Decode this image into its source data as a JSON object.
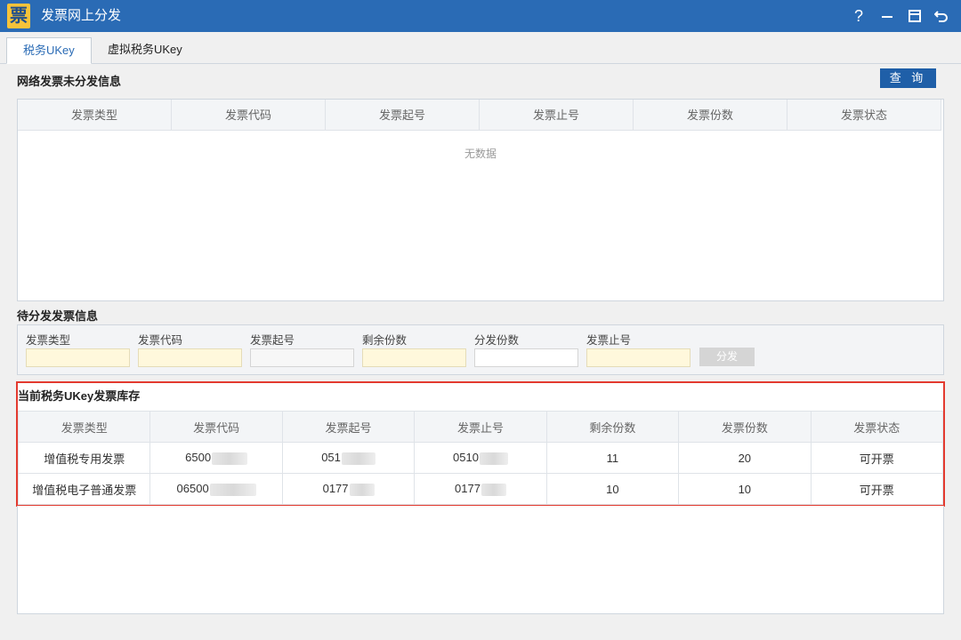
{
  "app": {
    "logo_char": "票",
    "title": "发票网上分发",
    "help_icon": "question-icon",
    "colors": {
      "titlebar": "#2a6bb5",
      "accent": "#1f5fa8",
      "highlight_border": "#e33a2f",
      "required_field": "#fff8dc"
    }
  },
  "tabs": [
    {
      "label": "税务UKey",
      "active": true
    },
    {
      "label": "虚拟税务UKey",
      "active": false
    }
  ],
  "online_pending": {
    "title": "网络发票未分发信息",
    "query_label": "查 询",
    "columns": [
      "发票类型",
      "发票代码",
      "发票起号",
      "发票止号",
      "发票份数",
      "发票状态"
    ],
    "empty_text": "无数据"
  },
  "to_distribute": {
    "title": "待分发发票信息",
    "fields": [
      {
        "label": "发票类型",
        "value": ""
      },
      {
        "label": "发票代码",
        "value": ""
      },
      {
        "label": "发票起号",
        "value": ""
      },
      {
        "label": "剩余份数",
        "value": ""
      },
      {
        "label": "分发份数",
        "value": ""
      },
      {
        "label": "发票止号",
        "value": ""
      }
    ],
    "distribute_label": "分发"
  },
  "inventory": {
    "title": "当前税务UKey发票库存",
    "columns": [
      "发票类型",
      "发票代码",
      "发票起号",
      "发票止号",
      "剩余份数",
      "发票份数",
      "发票状态"
    ],
    "rows": [
      [
        "增值税专用发票",
        "6500",
        "051",
        "0510",
        "11",
        "20",
        "可开票"
      ],
      [
        "增值税电子普通发票",
        "06500",
        "0177",
        "0177",
        "10",
        "10",
        "可开票"
      ]
    ]
  }
}
